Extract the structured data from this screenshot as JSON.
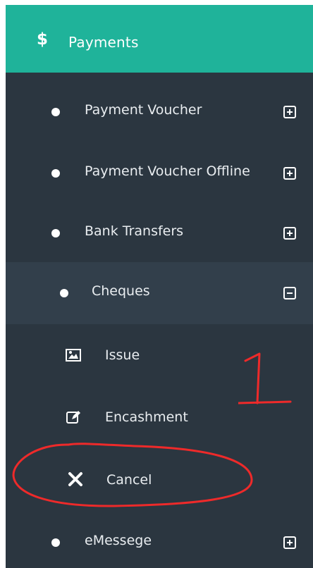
{
  "header": {
    "title": "Payments",
    "icon_glyph": "$"
  },
  "menu": {
    "items": [
      {
        "label": "Payment Voucher",
        "toggle": "plus"
      },
      {
        "label": "Payment Voucher Offline",
        "toggle": "plus"
      },
      {
        "label": "Bank Transfers",
        "toggle": "plus"
      },
      {
        "label": "Cheques",
        "toggle": "minus",
        "active": true
      },
      {
        "label": "eMessege",
        "toggle": "plus"
      }
    ],
    "cheques_subitems": [
      {
        "label": "Issue",
        "icon": "image-icon"
      },
      {
        "label": "Encashment",
        "icon": "edit-icon"
      },
      {
        "label": "Cancel",
        "icon": "close-icon"
      }
    ]
  },
  "annotation": {
    "number": "1",
    "color": "#ee2a2a"
  },
  "colors": {
    "header_bg": "#1fb39a",
    "sidebar_bg": "#2b3640",
    "active_bg": "#323f4b",
    "text": "#ffffff"
  }
}
